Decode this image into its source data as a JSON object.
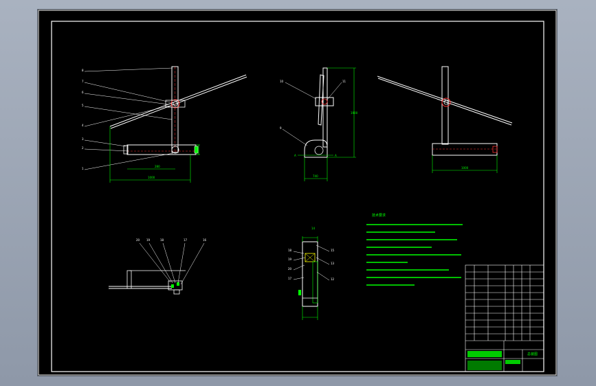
{
  "drawing": {
    "notes_heading": "技术要求",
    "title_block_name": "总装图",
    "view_labels": {
      "section_left": "A",
      "section_right": "A"
    },
    "part_callouts_front": [
      "8",
      "7",
      "6",
      "5",
      "4",
      "3",
      "2",
      "1"
    ],
    "part_callouts_side": [
      "10",
      "11",
      "9"
    ],
    "part_callouts_detail": [
      "20",
      "19",
      "18",
      "17",
      "16"
    ],
    "part_callouts_section": [
      "18",
      "19",
      "20",
      "17",
      "15",
      "13",
      "12",
      "14"
    ]
  },
  "colors": {
    "background": "#000000",
    "line": "#ffffff",
    "dimension": "#00ff00",
    "hidden": "#ff3333",
    "accent": "#ffff00",
    "frame": "#ffffff",
    "text": "#00ff00"
  }
}
